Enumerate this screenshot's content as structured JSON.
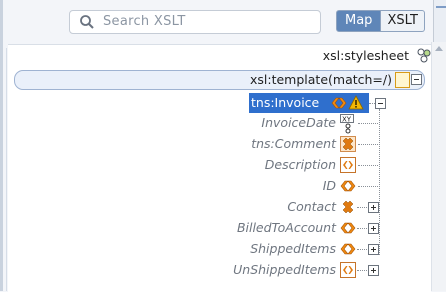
{
  "search": {
    "placeholder": "Search XSLT"
  },
  "tabs": [
    {
      "label": "Map",
      "active": true
    },
    {
      "label": "XSLT",
      "active": false
    }
  ],
  "tree": {
    "stylesheet": "xsl:stylesheet",
    "template": "xsl:template(match=/)",
    "invoice": "tns:Invoice",
    "children": [
      {
        "label": "InvoiceDate",
        "icon": "xy-attribute-icon"
      },
      {
        "label": "tns:Comment",
        "icon": "choice-icon"
      },
      {
        "label": "Description",
        "icon": "element-box-icon"
      },
      {
        "label": "ID",
        "icon": "element-icon"
      },
      {
        "label": "Contact",
        "icon": "choice-icon",
        "expandable": true
      },
      {
        "label": "BilledToAccount",
        "icon": "element-icon",
        "expandable": true
      },
      {
        "label": "ShippedItems",
        "icon": "element-icon",
        "expandable": true
      },
      {
        "label": "UnShippedItems",
        "icon": "element-box-icon",
        "expandable": true
      }
    ]
  },
  "colors": {
    "selection": "#2f6fcd",
    "tab_active": "#5f86b8",
    "element_icon": "#e07a10",
    "warning": "#f2b705"
  }
}
